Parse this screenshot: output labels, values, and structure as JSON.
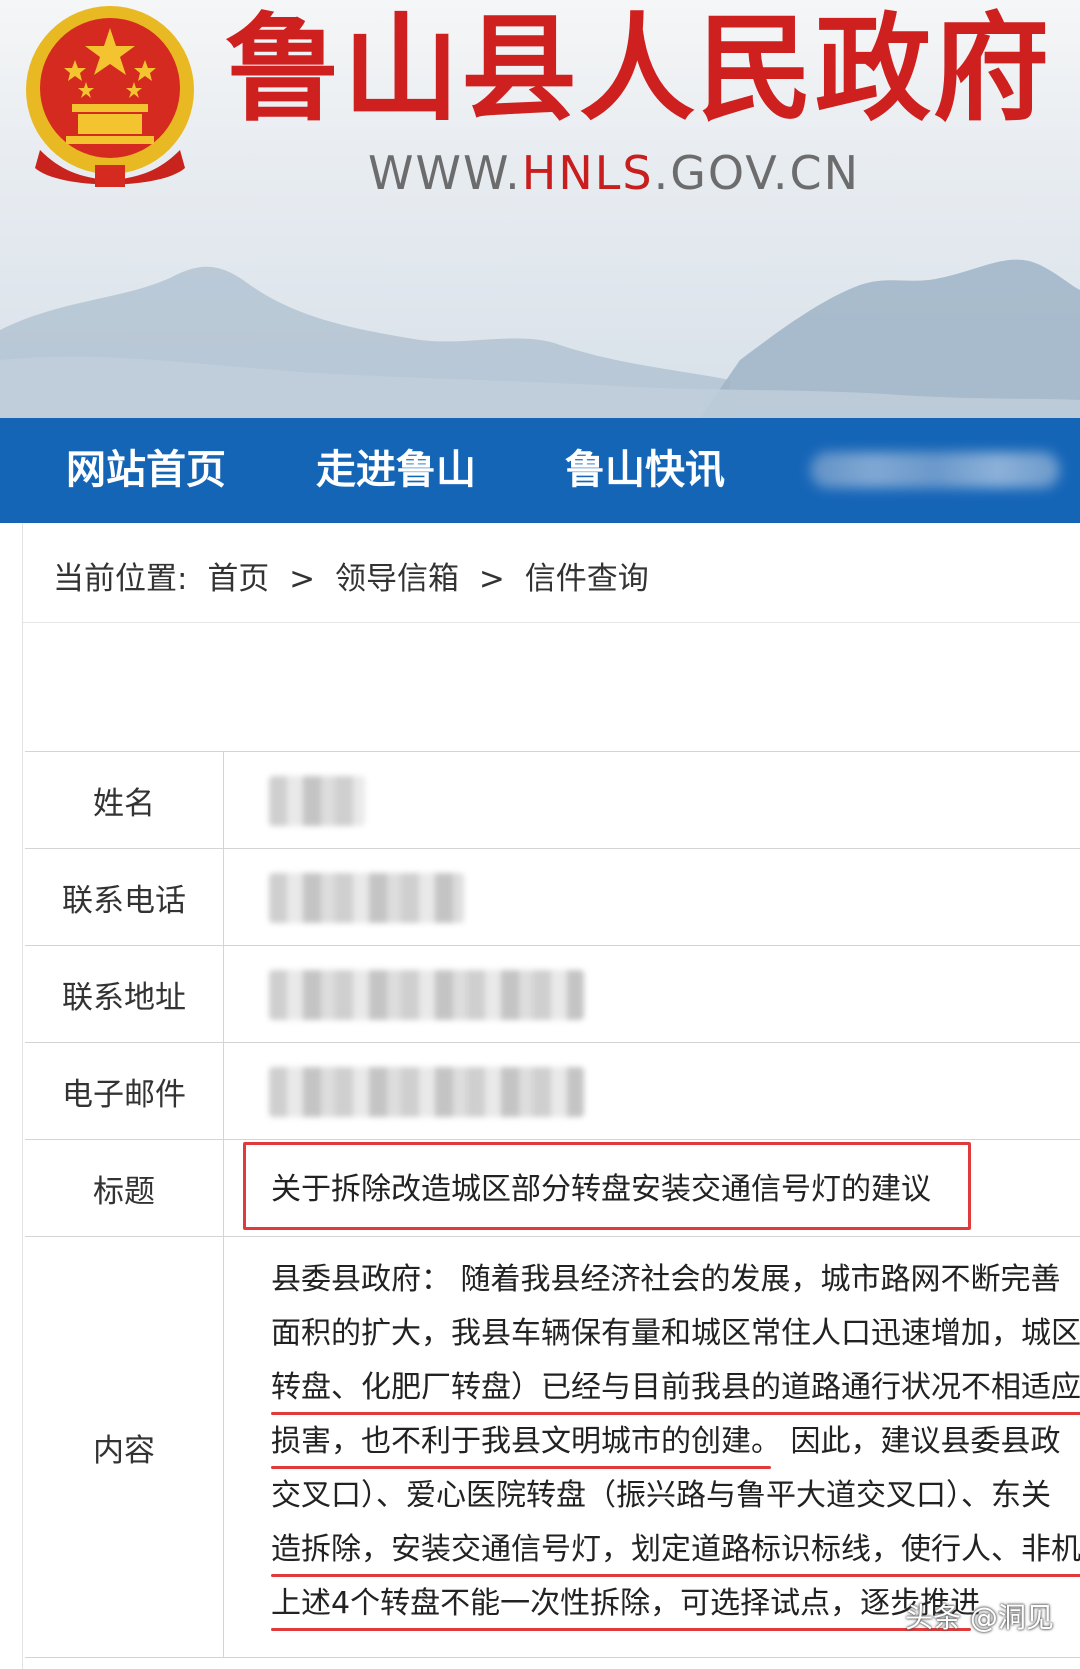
{
  "header": {
    "site_title": "鲁山县人民政府",
    "url_prefix": "WWW.",
    "url_highlight": "HNLS",
    "url_suffix": ".GOV.CN",
    "emblem_icon": "national-emblem-icon"
  },
  "nav": {
    "items": [
      {
        "label": "网站首页"
      },
      {
        "label": "走进鲁山"
      },
      {
        "label": "鲁山快讯"
      }
    ]
  },
  "breadcrumb": {
    "prefix": "当前位置:",
    "items": [
      "首页",
      "领导信箱",
      "信件查询"
    ],
    "separator": ">"
  },
  "letter": {
    "fields": {
      "name_label": "姓名",
      "phone_label": "联系电话",
      "address_label": "联系地址",
      "email_label": "电子邮件",
      "title_label": "标题",
      "content_label": "内容"
    },
    "title": "关于拆除改造城区部分转盘安装交通信号灯的建议",
    "content_lines": [
      "县委县政府： 随着我县经济社会的发展，城市路网不断完善",
      "面积的扩大，我县车辆保有量和城区常住人口迅速增加，城区",
      "转盘、化肥厂转盘）已经与目前我县的道路通行状况不相适应",
      "损害，也不利于我县文明城市的创建。 因此，建议县委县政",
      "交叉口）、爱心医院转盘（振兴路与鲁平大道交叉口）、东关",
      "造拆除，安装交通信号灯，划定道路标识标线，使行人、非机",
      "上述4个转盘不能一次性拆除，可选择试点，逐步推进"
    ]
  },
  "watermark": "头条 @洞见",
  "colors": {
    "title_red": "#cf2020",
    "nav_blue": "#1565b7",
    "highlight_red": "#e03a3a"
  }
}
